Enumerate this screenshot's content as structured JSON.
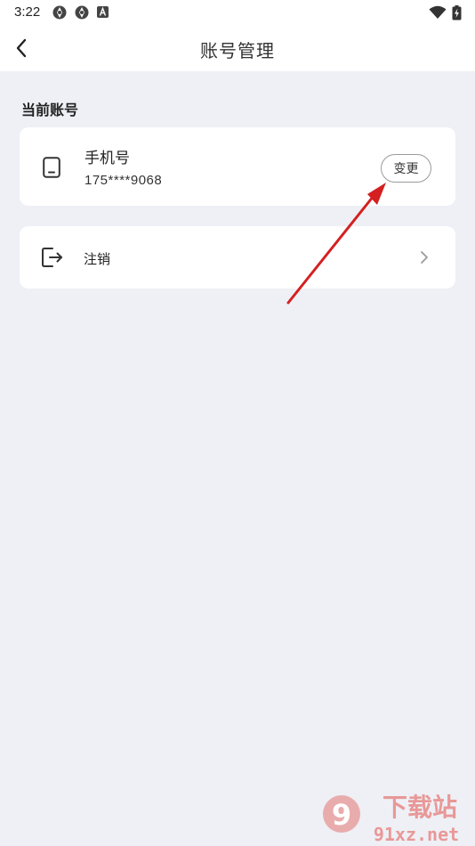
{
  "status_bar": {
    "time": "3:22",
    "icons": [
      "aperture-icon",
      "aperture-icon",
      "a-badge-icon"
    ],
    "right_icons": [
      "wifi-icon",
      "battery-icon"
    ]
  },
  "app_bar": {
    "title": "账号管理",
    "back_icon": "chevron-left-icon"
  },
  "section": {
    "label": "当前账号"
  },
  "phone_card": {
    "icon": "phone-icon",
    "title": "手机号",
    "number": "175****9068",
    "change_button": "变更"
  },
  "cancel_card": {
    "icon": "logout-icon",
    "label": "注销",
    "chevron_icon": "chevron-right-icon"
  },
  "annotation": {
    "arrow_color": "#d42020"
  },
  "watermark": {
    "text_top": "下载站",
    "text_bottom": "91xz.net",
    "logo_text": "9"
  },
  "colors": {
    "background": "#eef0f5",
    "card": "#ffffff",
    "text": "#222222"
  }
}
